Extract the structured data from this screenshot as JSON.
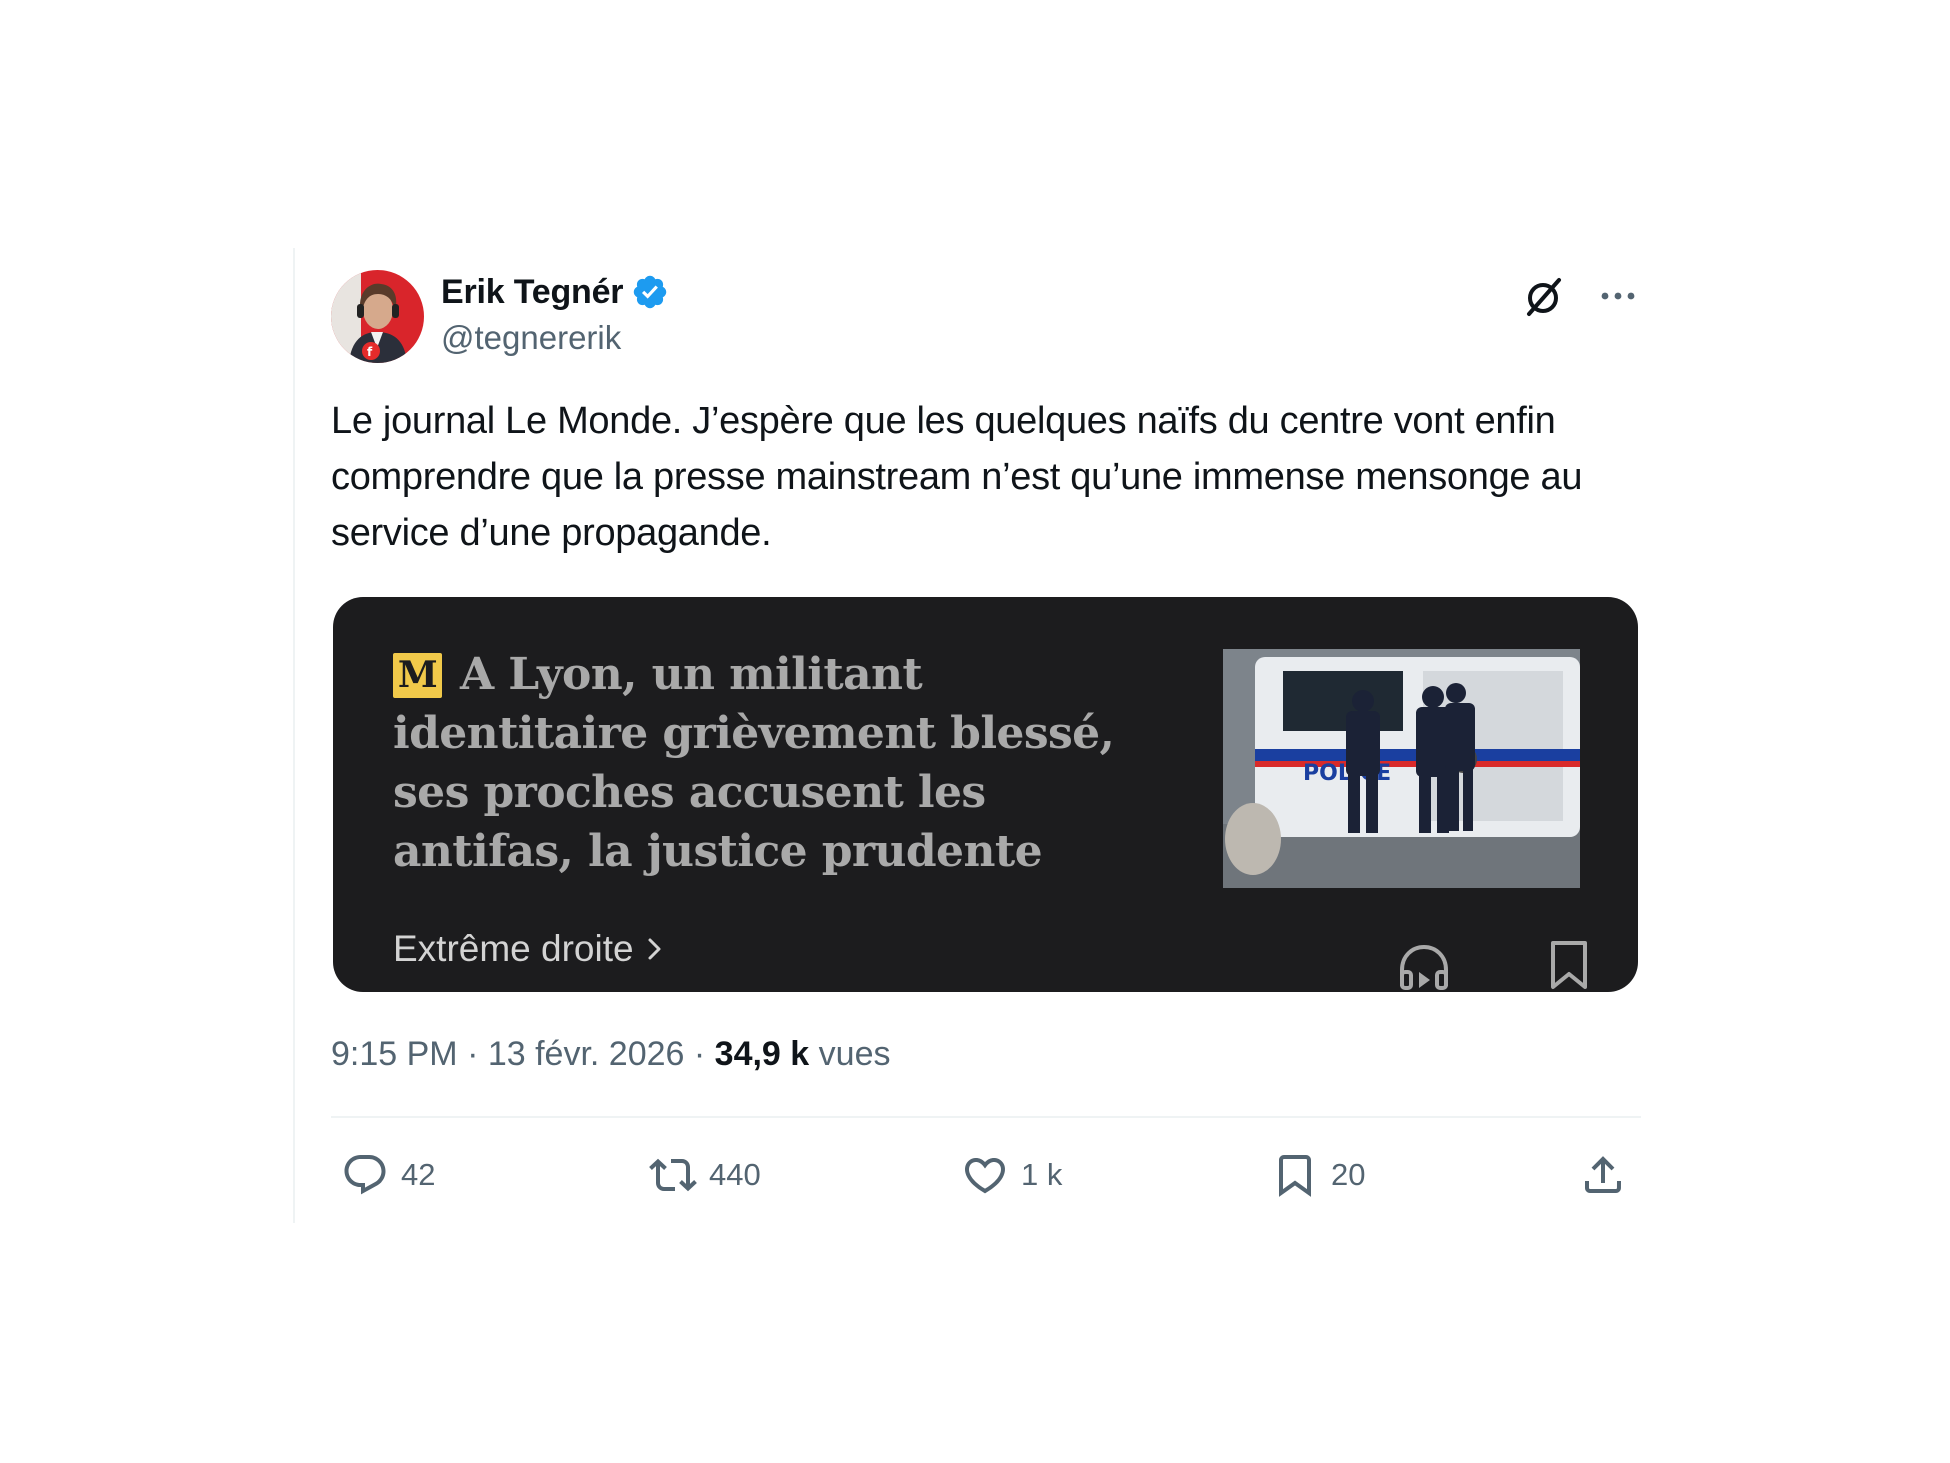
{
  "author": {
    "name": "Erik Tegnér",
    "handle": "@tegnererik",
    "verified": true
  },
  "icons": {
    "verified": "verified-badge-icon",
    "grok": "grok-icon",
    "more": "more-options-icon",
    "reply": "reply-icon",
    "repost": "repost-icon",
    "like": "heart-icon",
    "bookmark": "bookmark-icon",
    "share": "share-icon"
  },
  "tweet": {
    "text": "Le journal Le Monde. J’espère que les quelques naïfs du centre vont enfin comprendre que la presse mainstream n’est qu’une immense mensonge au service d’une propagande."
  },
  "card": {
    "logo_glyph": "M",
    "headline": "A Lyon, un militant identitaire grièvement blessé, ses proches accusent les antifas, la justice prudente",
    "section": "Extrême droite",
    "photo_label": "POLICE"
  },
  "meta": {
    "time": "9:15 PM",
    "separator": " · ",
    "date": "13 févr. 2026",
    "views_count": "34,9 k",
    "views_label": "vues"
  },
  "actions": {
    "replies": "42",
    "reposts": "440",
    "likes": "1 k",
    "bookmarks": "20"
  },
  "colors": {
    "text": "#0f1419",
    "secondary": "#536471",
    "verified": "#1d9bf0",
    "card_bg": "#1c1c1e",
    "logo_yellow": "#f1c94a"
  }
}
